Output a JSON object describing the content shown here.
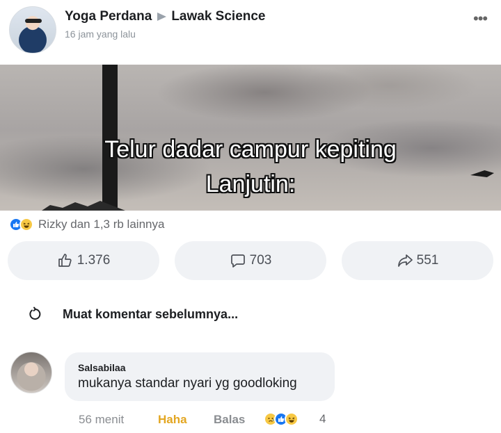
{
  "post": {
    "author": "Yoga Perdana",
    "group": "Lawak Science",
    "time": "16 jam yang lalu",
    "more_icon": "•••",
    "image": {
      "caption_line1": "Telur dadar campur kepiting",
      "caption_line2": "Lanjutin:"
    },
    "reactions": {
      "icons": [
        "like-icon",
        "haha-icon"
      ],
      "summary": "Rizky dan 1,3 rb lainnya"
    },
    "actions": {
      "like_count": "1.376",
      "comment_count": "703",
      "share_count": "551"
    }
  },
  "comments": {
    "load_previous": "Muat komentar sebelumnya...",
    "items": [
      {
        "name": "Salsabilaa",
        "text": "mukanya standar nyari yg goodloking",
        "time": "56 menit",
        "reaction_label": "Haha",
        "reply_label": "Balas",
        "reaction_icons": [
          "sad-icon",
          "like-icon",
          "haha-icon"
        ],
        "reaction_count": "4"
      }
    ]
  },
  "colors": {
    "accent": "#1877f2",
    "haha": "#e3a621",
    "pill_bg": "#f0f2f5",
    "muted_text": "#65676b"
  }
}
